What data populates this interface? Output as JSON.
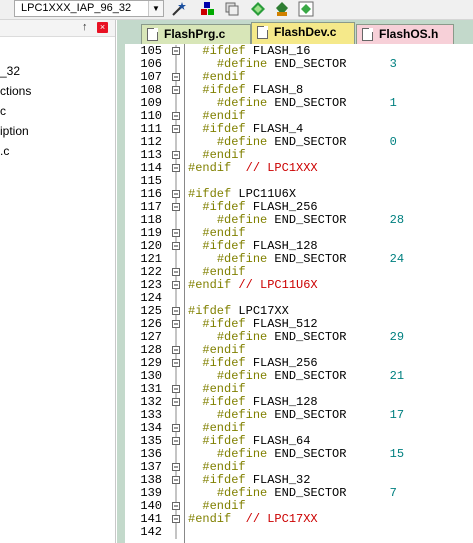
{
  "toolbar": {
    "target_value": "LPC1XXX_IAP_96_32",
    "icons": [
      "magic-wand-icon",
      "load-icon",
      "translate-icon",
      "download-icon",
      "diamond-icon"
    ]
  },
  "left_panel": {
    "items": [
      "_32",
      "ctions",
      "c",
      "iption",
      ".c"
    ],
    "pin_glyph": "↑",
    "close_glyph": "×"
  },
  "tabs": [
    {
      "label": "FlashPrg.c",
      "color": "#d8e6b8",
      "active": false
    },
    {
      "label": "FlashDev.c",
      "color": "#f5e98a",
      "active": true
    },
    {
      "label": "FlashOS.h",
      "color": "#f7d0d8",
      "active": false
    }
  ],
  "code": {
    "lines": [
      {
        "n": "105",
        "fold": "-",
        "t": "  #ifdef FLASH_16"
      },
      {
        "n": "106",
        "fold": "",
        "t": "    #define END_SECTOR      3"
      },
      {
        "n": "107",
        "fold": "-",
        "t": "  #endif"
      },
      {
        "n": "108",
        "fold": "-",
        "t": "  #ifdef FLASH_8"
      },
      {
        "n": "109",
        "fold": "",
        "t": "    #define END_SECTOR      1"
      },
      {
        "n": "110",
        "fold": "-",
        "t": "  #endif"
      },
      {
        "n": "111",
        "fold": "-",
        "t": "  #ifdef FLASH_4"
      },
      {
        "n": "112",
        "fold": "",
        "t": "    #define END_SECTOR      0"
      },
      {
        "n": "113",
        "fold": "-",
        "t": "  #endif"
      },
      {
        "n": "114",
        "fold": "-",
        "t": "#endif  // LPC1XXX"
      },
      {
        "n": "115",
        "fold": "",
        "t": ""
      },
      {
        "n": "116",
        "fold": "-",
        "t": "#ifdef LPC11U6X"
      },
      {
        "n": "117",
        "fold": "-",
        "t": "  #ifdef FLASH_256"
      },
      {
        "n": "118",
        "fold": "",
        "t": "    #define END_SECTOR      28"
      },
      {
        "n": "119",
        "fold": "-",
        "t": "  #endif"
      },
      {
        "n": "120",
        "fold": "-",
        "t": "  #ifdef FLASH_128"
      },
      {
        "n": "121",
        "fold": "",
        "t": "    #define END_SECTOR      24"
      },
      {
        "n": "122",
        "fold": "-",
        "t": "  #endif"
      },
      {
        "n": "123",
        "fold": "-",
        "t": "#endif // LPC11U6X"
      },
      {
        "n": "124",
        "fold": "",
        "t": ""
      },
      {
        "n": "125",
        "fold": "-",
        "t": "#ifdef LPC17XX"
      },
      {
        "n": "126",
        "fold": "-",
        "t": "  #ifdef FLASH_512"
      },
      {
        "n": "127",
        "fold": "",
        "t": "    #define END_SECTOR      29"
      },
      {
        "n": "128",
        "fold": "-",
        "t": "  #endif"
      },
      {
        "n": "129",
        "fold": "-",
        "t": "  #ifdef FLASH_256"
      },
      {
        "n": "130",
        "fold": "",
        "t": "    #define END_SECTOR      21"
      },
      {
        "n": "131",
        "fold": "-",
        "t": "  #endif"
      },
      {
        "n": "132",
        "fold": "-",
        "t": "  #ifdef FLASH_128"
      },
      {
        "n": "133",
        "fold": "",
        "t": "    #define END_SECTOR      17"
      },
      {
        "n": "134",
        "fold": "-",
        "t": "  #endif"
      },
      {
        "n": "135",
        "fold": "-",
        "t": "  #ifdef FLASH_64"
      },
      {
        "n": "136",
        "fold": "",
        "t": "    #define END_SECTOR      15"
      },
      {
        "n": "137",
        "fold": "-",
        "t": "  #endif"
      },
      {
        "n": "138",
        "fold": "-",
        "t": "  #ifdef FLASH_32"
      },
      {
        "n": "139",
        "fold": "",
        "t": "    #define END_SECTOR      7"
      },
      {
        "n": "140",
        "fold": "-",
        "t": "  #endif"
      },
      {
        "n": "141",
        "fold": "-",
        "t": "#endif  // LPC17XX"
      },
      {
        "n": "142",
        "fold": "",
        "t": ""
      }
    ]
  }
}
